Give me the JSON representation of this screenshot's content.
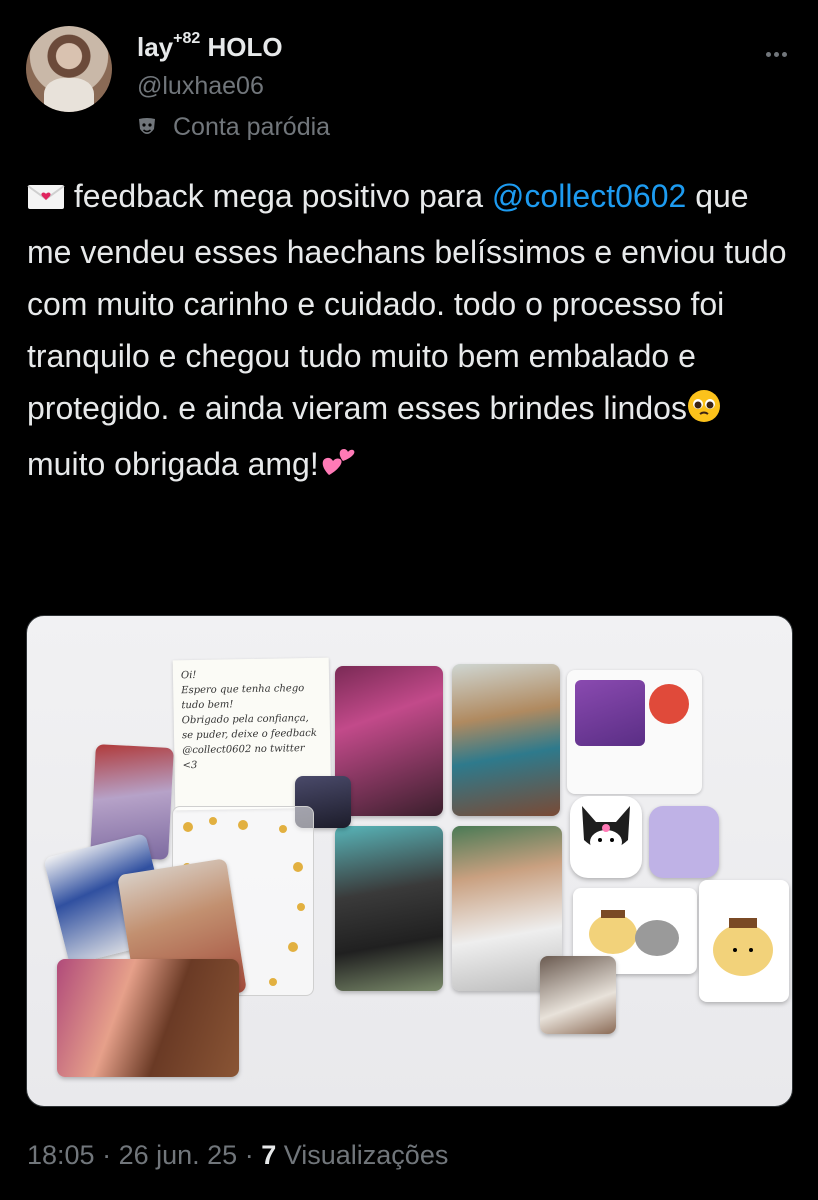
{
  "user": {
    "display_name": "lay",
    "name_superscript": "+82",
    "name_suffix": " HOLO",
    "handle": "@luxhae06",
    "badge_label": "Conta paródia"
  },
  "tweet": {
    "emoji_start": "💌",
    "text_1": " feedback mega positivo para ",
    "mention": "@collect0602",
    "text_2": " que me vendeu esses haechans belíssimos e enviou tudo com muito carinho e cuidado. todo o processo foi tranquilo e chegou tudo muito bem embalado e protegido. e ainda vieram esses brindes lindos",
    "emoji_mid": "🥺",
    "text_3": " muito obrigada amg!",
    "emoji_end": "💕"
  },
  "media": {
    "note_lines": [
      "Oi!",
      "Espero que tenha chego",
      "tudo bem!",
      "Obrigado pela confiança,",
      "se puder, deixe o feedback",
      "@collect0602 no twitter",
      "<3"
    ]
  },
  "meta": {
    "time": "18:05",
    "date": "26 jun. 25",
    "views_count": "7",
    "views_label": "Visualizações"
  },
  "colors": {
    "background": "#000000",
    "text": "#e7e9ea",
    "secondary": "#71767b",
    "link": "#1d9bf0"
  }
}
